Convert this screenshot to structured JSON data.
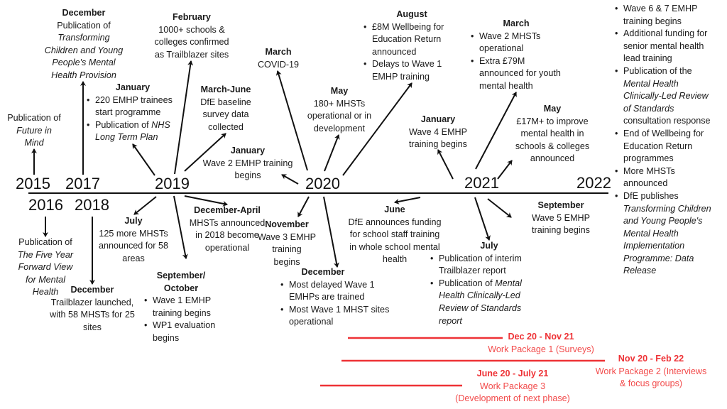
{
  "years": [
    "2015",
    "2016",
    "2017",
    "2018",
    "2019",
    "2020",
    "2021",
    "2022"
  ],
  "accent_color": "#ee3236",
  "events": [
    {
      "month": "",
      "lines": [
        [
          {
            "text": "Publication of"
          }
        ],
        [
          {
            "text": "Future in",
            "italic": true
          }
        ],
        [
          {
            "text": "Mind",
            "italic": true
          }
        ]
      ]
    },
    {
      "month": "December",
      "lines": [
        [
          {
            "text": "Publication of"
          }
        ],
        [
          {
            "text": "Transforming",
            "italic": true
          }
        ],
        [
          {
            "text": "Children and Young",
            "italic": true
          }
        ],
        [
          {
            "text": "People's Mental",
            "italic": true
          }
        ],
        [
          {
            "text": "Health Provision",
            "italic": true
          }
        ]
      ]
    },
    {
      "month": "February",
      "lines": [
        [
          {
            "text": "1000+ schools &"
          }
        ],
        [
          {
            "text": "colleges confirmed"
          }
        ],
        [
          {
            "text": "as Trailblazer sites"
          }
        ]
      ]
    },
    {
      "month": "January",
      "bullets": [
        [
          [
            {
              "text": "220 EMHP trainees"
            }
          ],
          [
            {
              "text": "start programme"
            }
          ]
        ],
        [
          [
            {
              "text": "Publication of "
            },
            {
              "text": "NHS",
              "italic": true
            }
          ],
          [
            {
              "text": "Long Term Plan",
              "italic": true
            }
          ]
        ]
      ]
    },
    {
      "month": "March-June",
      "lines": [
        [
          {
            "text": "DfE baseline"
          }
        ],
        [
          {
            "text": "survey data"
          }
        ],
        [
          {
            "text": "collected"
          }
        ]
      ]
    },
    {
      "month": "March",
      "lines": [
        [
          {
            "text": "COVID-19"
          }
        ]
      ]
    },
    {
      "month": "January",
      "lines": [
        [
          {
            "text": "Wave 2 EMHP training"
          }
        ],
        [
          {
            "text": "begins"
          }
        ]
      ]
    },
    {
      "month": "May",
      "lines": [
        [
          {
            "text": "180+ MHSTs"
          }
        ],
        [
          {
            "text": "operational or in"
          }
        ],
        [
          {
            "text": "development"
          }
        ]
      ]
    },
    {
      "month": "August",
      "bullets": [
        [
          [
            {
              "text": "£8M Wellbeing for"
            }
          ],
          [
            {
              "text": "Education Return"
            }
          ],
          [
            {
              "text": "announced"
            }
          ]
        ],
        [
          [
            {
              "text": "Delays to Wave 1"
            }
          ],
          [
            {
              "text": "EMHP training"
            }
          ]
        ]
      ]
    },
    {
      "month": "January",
      "lines": [
        [
          {
            "text": "Wave 4 EMHP"
          }
        ],
        [
          {
            "text": "training begins"
          }
        ]
      ]
    },
    {
      "month": "March",
      "bullets": [
        [
          [
            {
              "text": "Wave 2 MHSTs"
            }
          ],
          [
            {
              "text": "operational"
            }
          ]
        ],
        [
          [
            {
              "text": "Extra £79M"
            }
          ],
          [
            {
              "text": "announced for youth"
            }
          ],
          [
            {
              "text": "mental health"
            }
          ]
        ]
      ]
    },
    {
      "month": "May",
      "lines": [
        [
          {
            "text": "£17M+ to improve"
          }
        ],
        [
          {
            "text": "mental health in"
          }
        ],
        [
          {
            "text": "schools & colleges"
          }
        ],
        [
          {
            "text": "announced"
          }
        ]
      ]
    },
    {
      "month": "",
      "bullets": [
        [
          [
            {
              "text": "Wave 6 & 7 EMHP"
            }
          ],
          [
            {
              "text": "training begins"
            }
          ]
        ],
        [
          [
            {
              "text": "Additional funding for"
            }
          ],
          [
            {
              "text": "senior mental health"
            }
          ],
          [
            {
              "text": "lead training"
            }
          ]
        ],
        [
          [
            {
              "text": "Publication of the"
            }
          ],
          [
            {
              "text": "Mental Health",
              "italic": true
            }
          ],
          [
            {
              "text": "Clinically-Led Review",
              "italic": true
            }
          ],
          [
            {
              "text": "of Standards",
              "italic": true
            }
          ],
          [
            {
              "text": "consultation response"
            }
          ]
        ],
        [
          [
            {
              "text": "End of Wellbeing for"
            }
          ],
          [
            {
              "text": "Education Return"
            }
          ],
          [
            {
              "text": "programmes"
            }
          ]
        ],
        [
          [
            {
              "text": "More MHSTs"
            }
          ],
          [
            {
              "text": "announced"
            }
          ]
        ],
        [
          [
            {
              "text": "DfE publishes"
            }
          ],
          [
            {
              "text": "Transforming Children",
              "italic": true
            }
          ],
          [
            {
              "text": "and Young People's",
              "italic": true
            }
          ],
          [
            {
              "text": "Mental Health",
              "italic": true
            }
          ],
          [
            {
              "text": "Implementation",
              "italic": true
            }
          ],
          [
            {
              "text": "Programme: Data",
              "italic": true
            }
          ],
          [
            {
              "text": "Release",
              "italic": true
            }
          ]
        ]
      ]
    },
    {
      "month": "",
      "lines": [
        [
          {
            "text": "Publication of"
          }
        ],
        [
          {
            "text": "The Five Year",
            "italic": true
          }
        ],
        [
          {
            "text": "Forward View",
            "italic": true
          }
        ],
        [
          {
            "text": "for Mental",
            "italic": true
          }
        ],
        [
          {
            "text": "Health",
            "italic": true
          }
        ]
      ]
    },
    {
      "month": "December",
      "lines": [
        [
          {
            "text": "Trailblazer launched,"
          }
        ],
        [
          {
            "text": "with 58 MHSTs for 25"
          }
        ],
        [
          {
            "text": "sites"
          }
        ]
      ]
    },
    {
      "month": "July",
      "lines": [
        [
          {
            "text": "125 more MHSTs"
          }
        ],
        [
          {
            "text": "announced for 58"
          }
        ],
        [
          {
            "text": "areas"
          }
        ]
      ]
    },
    {
      "month": "December-April",
      "lines": [
        [
          {
            "text": "MHSTs announced"
          }
        ],
        [
          {
            "text": "in 2018 become"
          }
        ],
        [
          {
            "text": "operational"
          }
        ]
      ]
    },
    {
      "month": "September/ October",
      "bullets": [
        [
          [
            {
              "text": "Wave 1 EMHP"
            }
          ],
          [
            {
              "text": "training begins"
            }
          ]
        ],
        [
          [
            {
              "text": "WP1 evaluation"
            }
          ],
          [
            {
              "text": "begins"
            }
          ]
        ]
      ]
    },
    {
      "month": "November",
      "lines": [
        [
          {
            "text": "Wave 3 EMHP"
          }
        ],
        [
          {
            "text": "training"
          }
        ],
        [
          {
            "text": "begins"
          }
        ]
      ]
    },
    {
      "month": "December",
      "bullets": [
        [
          [
            {
              "text": "Most delayed Wave 1"
            }
          ],
          [
            {
              "text": "EMHPs are trained"
            }
          ]
        ],
        [
          [
            {
              "text": "Most Wave 1 MHST sites"
            }
          ],
          [
            {
              "text": "operational"
            }
          ]
        ]
      ]
    },
    {
      "month": "June",
      "lines": [
        [
          {
            "text": "DfE announces funding"
          }
        ],
        [
          {
            "text": "for school staff training"
          }
        ],
        [
          {
            "text": "in whole school mental"
          }
        ],
        [
          {
            "text": "health"
          }
        ]
      ]
    },
    {
      "month": "July",
      "bullets": [
        [
          [
            {
              "text": "Publication of interim"
            }
          ],
          [
            {
              "text": "Trailblazer report"
            }
          ]
        ],
        [
          [
            {
              "text": "Publication of "
            },
            {
              "text": "Mental",
              "italic": true
            }
          ],
          [
            {
              "text": "Health Clinically-Led",
              "italic": true
            }
          ],
          [
            {
              "text": "Review of Standards",
              "italic": true
            }
          ],
          [
            {
              "text": "report",
              "italic": true
            }
          ]
        ]
      ]
    },
    {
      "month": "September",
      "lines": [
        [
          {
            "text": "Wave 5 EMHP"
          }
        ],
        [
          {
            "text": "training begins"
          }
        ]
      ]
    }
  ],
  "work_packages": [
    {
      "range": "Dec 20 - Nov 21",
      "label_lines": [
        "Work Package 1 (Surveys)"
      ]
    },
    {
      "range": "Nov 20 -  Feb 22",
      "label_lines": [
        "Work Package 2 (Interviews",
        "& focus groups)"
      ]
    },
    {
      "range": "June 20 - July 21",
      "label_lines": [
        "Work Package 3",
        "(Development of next phase)"
      ]
    }
  ]
}
